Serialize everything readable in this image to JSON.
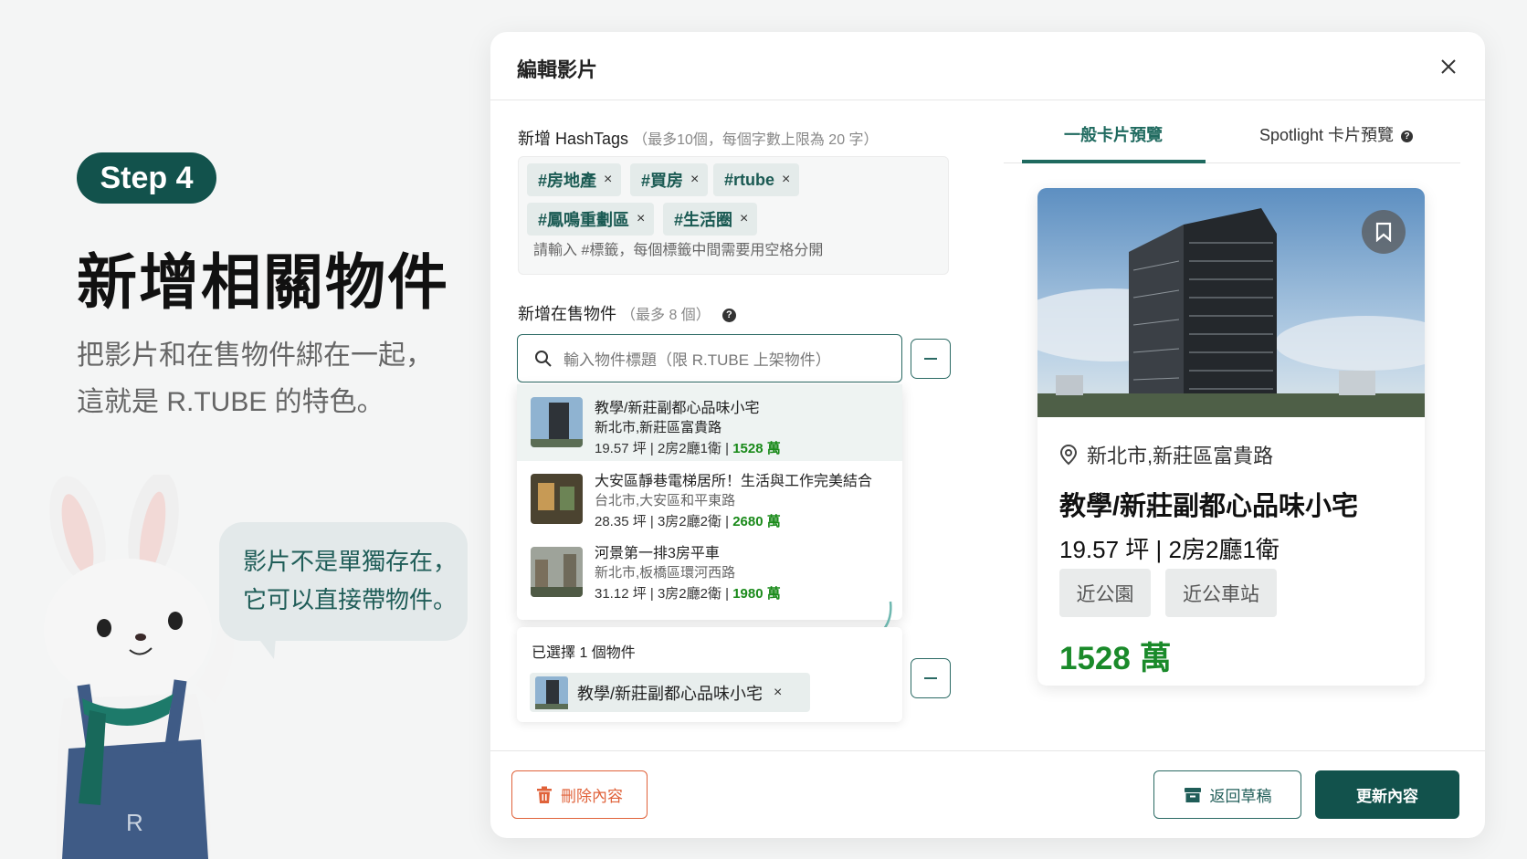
{
  "hero": {
    "step": "Step 4",
    "title": "新增相關物件",
    "desc_line1": "把影片和在售物件綁在一起，",
    "desc_line2": "這就是 R.TUBE 的特色。"
  },
  "bubble": {
    "line1": "影片不是單獨存在，",
    "line2": "它可以直接帶物件。"
  },
  "modal": {
    "title": "編輯影片",
    "close": "×"
  },
  "hashtags": {
    "label": "新增 HashTags",
    "hint": "（最多10個，每個字數上限為 20 字）",
    "tags": [
      "#房地產",
      "#買房",
      "#rtube",
      "#鳳鳴重劃區",
      "#生活圈"
    ],
    "remove": "×",
    "placeholder": "請輸入 #標籤，每個標籤中間需要用空格分開"
  },
  "listings": {
    "label": "新增在售物件",
    "hint": "（最多 8 個）",
    "help": "?",
    "search_placeholder": "輸入物件標題（限 R.TUBE 上架物件）",
    "results": [
      {
        "title": "教學/新莊副都心品味小宅",
        "address": "新北市,新莊區富貴路",
        "size": "19.57 坪",
        "layout": "2房2廳1衛",
        "price": "1528 萬"
      },
      {
        "title": "大安區靜巷電梯居所！生活與工作完美結合",
        "address": "台北市,大安區和平東路",
        "size": "28.35 坪",
        "layout": "3房2廳2衛",
        "price": "2680 萬"
      },
      {
        "title": "河景第一排3房平車",
        "address": "新北市,板橋區環河西路",
        "size": "31.12 坪",
        "layout": "3房2廳2衛",
        "price": "1980 萬"
      }
    ],
    "selected_label": "已選擇 1 個物件",
    "selected_item": "教學/新莊副都心品味小宅",
    "selected_remove": "×"
  },
  "preview": {
    "tab_general": "一般卡片預覽",
    "tab_spotlight": "Spotlight 卡片預覽",
    "address": "新北市,新莊區富貴路",
    "title": "教學/新莊副都心品味小宅",
    "size": "19.57 坪",
    "sep": "|",
    "layout": "2房2廳1衛",
    "features": [
      "近公園",
      "近公車站"
    ],
    "price": "1528 萬"
  },
  "footer": {
    "delete": "刪除內容",
    "draft": "返回草稿",
    "update": "更新內容"
  },
  "colors": {
    "brand": "#12524c",
    "price": "#1a8a1a",
    "danger": "#e0623a"
  }
}
